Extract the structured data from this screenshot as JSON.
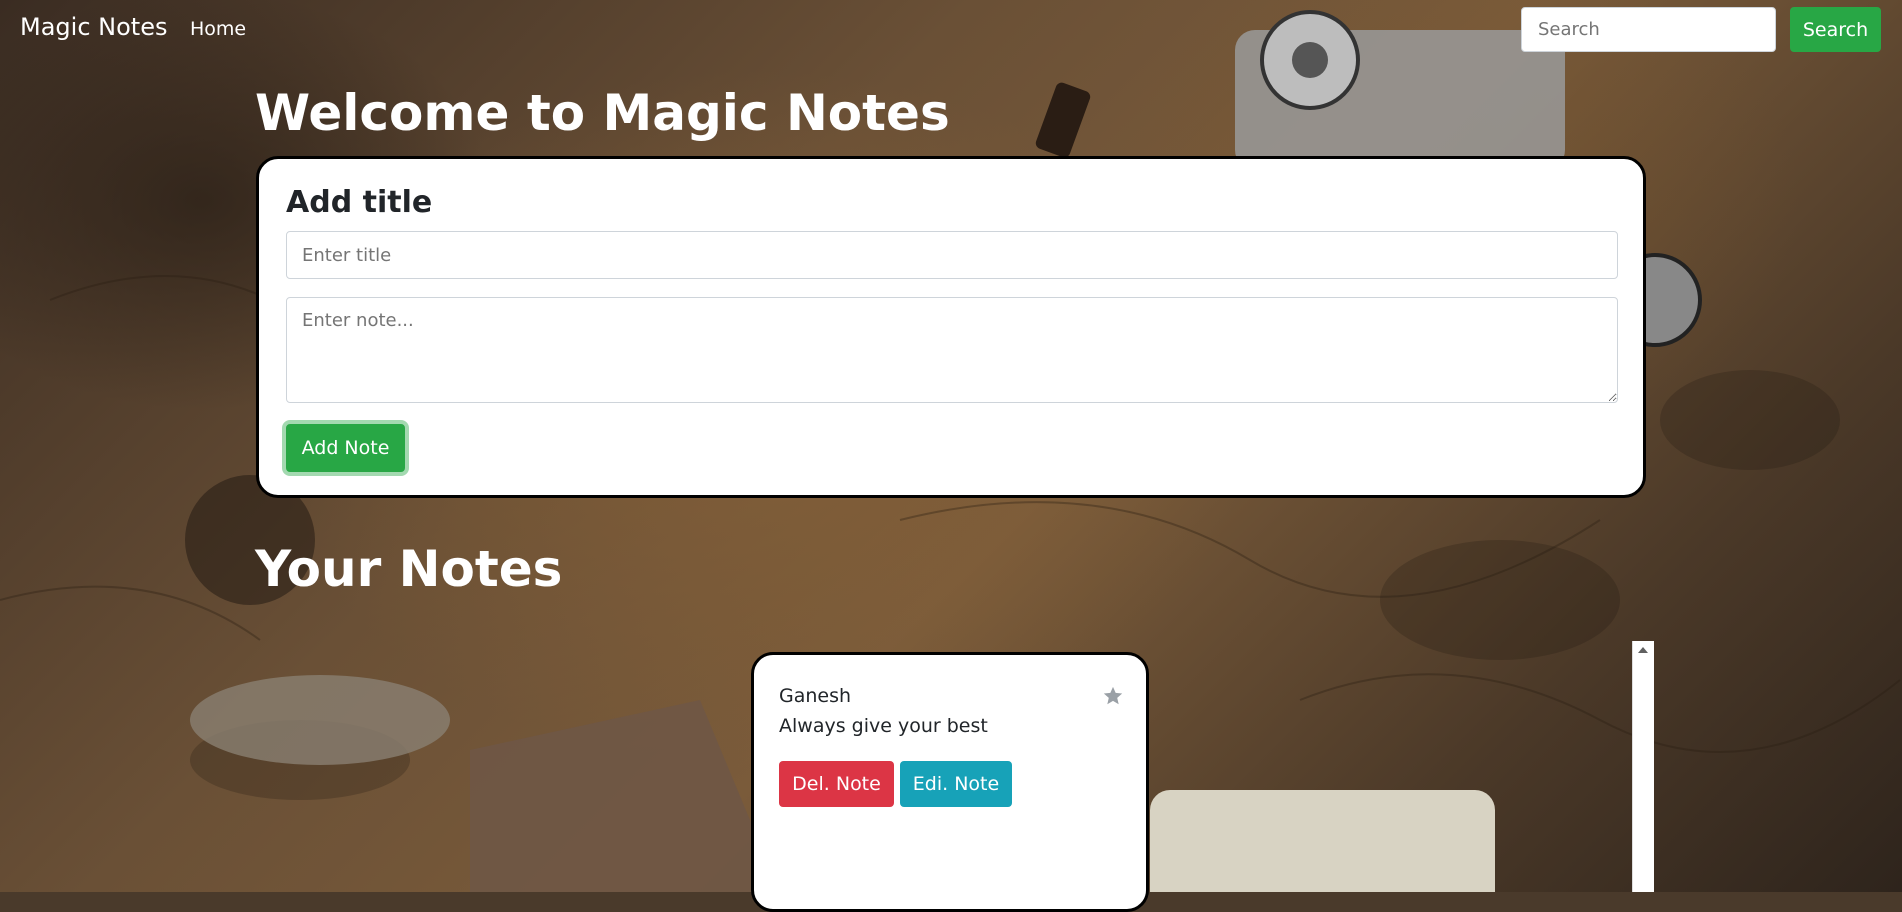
{
  "navbar": {
    "brand": "Magic Notes",
    "home_label": "Home",
    "search_placeholder": "Search",
    "search_button": "Search"
  },
  "heading": "Welcome to Magic Notes",
  "add_card": {
    "title": "Add title",
    "title_placeholder": "Enter title",
    "note_placeholder": "Enter note...",
    "add_button": "Add Note"
  },
  "notes_heading": "Your Notes",
  "notes": [
    {
      "title": "Ganesh",
      "text": "Always give your best",
      "delete_label": "Del. Note",
      "edit_label": "Edi. Note",
      "star_icon": "star-icon"
    }
  ],
  "colors": {
    "success": "#28a745",
    "danger": "#dc3545",
    "info": "#17a2b8",
    "card_border": "#000000"
  }
}
